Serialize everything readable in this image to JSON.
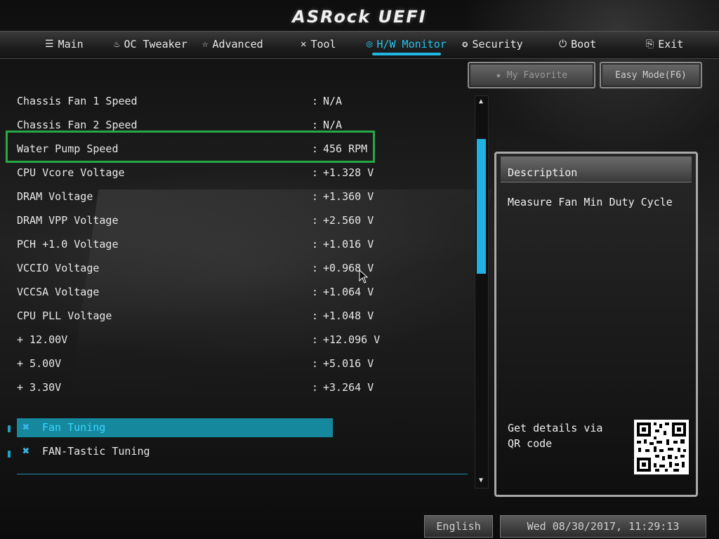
{
  "brand": "ASRock UEFI",
  "nav": {
    "tabs": [
      {
        "label": "Main",
        "icon": "list-icon"
      },
      {
        "label": "OC Tweaker",
        "icon": "flame-icon"
      },
      {
        "label": "Advanced",
        "icon": "star-icon"
      },
      {
        "label": "Tool",
        "icon": "tools-icon"
      },
      {
        "label": "H/W Monitor",
        "icon": "monitor-icon",
        "active": true
      },
      {
        "label": "Security",
        "icon": "shield-icon"
      },
      {
        "label": "Boot",
        "icon": "power-icon"
      },
      {
        "label": "Exit",
        "icon": "exit-icon"
      }
    ]
  },
  "buttons": {
    "favorite": "My Favorite",
    "easy_mode": "Easy Mode(F6)"
  },
  "readings": [
    {
      "label": "Chassis Fan 1 Speed",
      "value": "N/A"
    },
    {
      "label": "Chassis Fan 2 Speed",
      "value": "N/A"
    },
    {
      "label": "Water Pump Speed",
      "value": "456 RPM"
    },
    {
      "label": "CPU Vcore Voltage",
      "value": "+1.328 V"
    },
    {
      "label": "DRAM Voltage",
      "value": "+1.360 V"
    },
    {
      "label": "DRAM VPP Voltage",
      "value": "+2.560 V"
    },
    {
      "label": "PCH +1.0 Voltage",
      "value": "+1.016 V"
    },
    {
      "label": "VCCIO Voltage",
      "value": "+0.968 V"
    },
    {
      "label": "VCCSA Voltage",
      "value": "+1.064 V"
    },
    {
      "label": "CPU PLL Voltage",
      "value": "+1.048 V"
    },
    {
      "label": "+ 12.00V",
      "value": "+12.096 V"
    },
    {
      "label": "+ 5.00V",
      "value": "+5.016 V"
    },
    {
      "label": "+ 3.30V",
      "value": "+3.264 V"
    }
  ],
  "colon": ":",
  "submenus": [
    {
      "label": "Fan Tuning",
      "selected": true
    },
    {
      "label": "FAN-Tastic Tuning",
      "selected": false
    }
  ],
  "description": {
    "title": "Description",
    "text": "Measure Fan Min Duty Cycle",
    "qr_text": "Get details via QR code"
  },
  "footer": {
    "language": "English",
    "datetime": "Wed 08/30/2017, 11:29:13"
  },
  "colors": {
    "accent": "#1fb6e0",
    "highlight_box": "#27a844"
  }
}
